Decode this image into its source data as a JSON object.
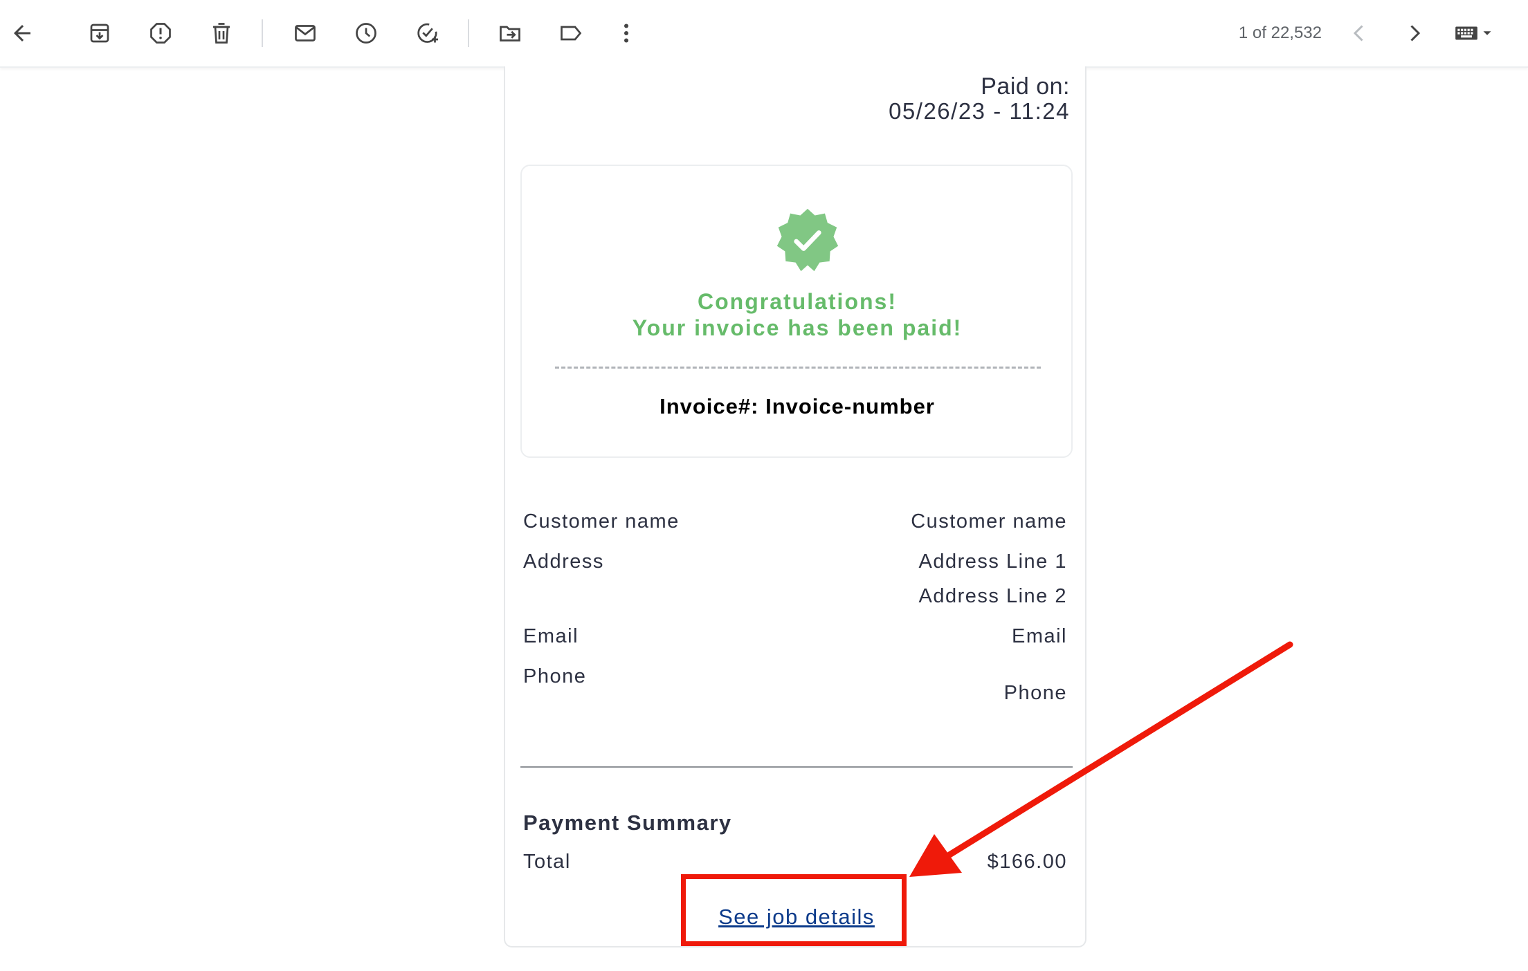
{
  "toolbar": {
    "counter": "1 of 22,532",
    "icons": [
      "back-arrow-icon",
      "archive-icon",
      "report-spam-icon",
      "delete-icon",
      "mark-unread-icon",
      "snooze-icon",
      "add-task-icon",
      "move-to-icon",
      "label-icon",
      "more-vert-icon",
      "chevron-left-icon",
      "chevron-right-icon",
      "keyboard-icon",
      "dropdown-caret-icon"
    ]
  },
  "email": {
    "paid_label": "Paid on:",
    "paid_date": "05/26/23 - 11:24",
    "congrats_line1": "Congratulations!",
    "congrats_line2": "Your invoice has been paid!",
    "invoice_number": "Invoice#: Invoice-number",
    "customer": {
      "name_label": "Customer name",
      "name_value": "Customer name",
      "address_label": "Address",
      "address_line1": "Address Line 1",
      "address_line2": "Address Line 2",
      "email_label": "Email",
      "email_value": "Email",
      "phone_label": "Phone",
      "phone_value": "Phone"
    },
    "payment_summary_title": "Payment Summary",
    "total_label": "Total",
    "total_value": "$166.00",
    "job_details_link": "See job details"
  },
  "colors": {
    "success_green": "#66bb6a",
    "badge_green": "#81c784",
    "link_blue": "#0b3a8a",
    "annotation_red": "#ef1a0a",
    "text_dark": "#2d3142"
  }
}
